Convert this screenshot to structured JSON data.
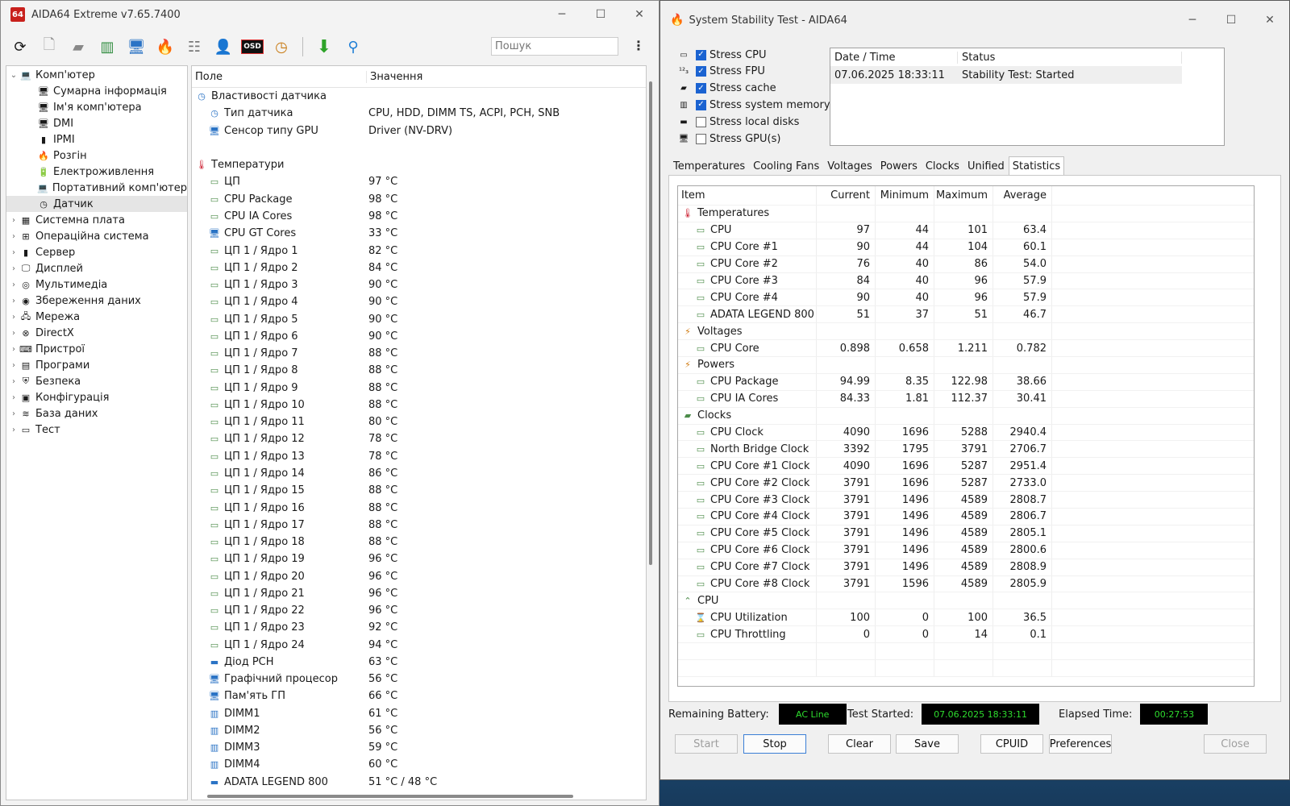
{
  "left_window": {
    "logo": "64",
    "title": "AIDA64 Extreme v7.65.7400",
    "search_placeholder": "Пошук",
    "tree": [
      {
        "label": "Комп'ютер",
        "indent": 0,
        "expanded": true,
        "icon": "💻"
      },
      {
        "label": "Сумарна інформація",
        "indent": 1,
        "icon": "🖥"
      },
      {
        "label": "Ім'я комп'ютера",
        "indent": 1,
        "icon": "🖥"
      },
      {
        "label": "DMI",
        "indent": 1,
        "icon": "🖥"
      },
      {
        "label": "IPMI",
        "indent": 1,
        "icon": "▮"
      },
      {
        "label": "Розгін",
        "indent": 1,
        "icon": "🔥"
      },
      {
        "label": "Електроживлення",
        "indent": 1,
        "icon": "🔋"
      },
      {
        "label": "Портативний комп'ютер",
        "indent": 1,
        "icon": "💻"
      },
      {
        "label": "Датчик",
        "indent": 1,
        "icon": "◷",
        "selected": true
      },
      {
        "label": "Системна плата",
        "indent": 0,
        "icon": "▦"
      },
      {
        "label": "Операційна система",
        "indent": 0,
        "icon": "⊞"
      },
      {
        "label": "Сервер",
        "indent": 0,
        "icon": "▮"
      },
      {
        "label": "Дисплей",
        "indent": 0,
        "icon": "🖵"
      },
      {
        "label": "Мультимедіа",
        "indent": 0,
        "icon": "◎"
      },
      {
        "label": "Збереження даних",
        "indent": 0,
        "icon": "◉"
      },
      {
        "label": "Мережа",
        "indent": 0,
        "icon": "🖧"
      },
      {
        "label": "DirectX",
        "indent": 0,
        "icon": "⊗"
      },
      {
        "label": "Пристрої",
        "indent": 0,
        "icon": "⌨"
      },
      {
        "label": "Програми",
        "indent": 0,
        "icon": "▤"
      },
      {
        "label": "Безпека",
        "indent": 0,
        "icon": "⛨"
      },
      {
        "label": "Конфігурація",
        "indent": 0,
        "icon": "▣"
      },
      {
        "label": "База даних",
        "indent": 0,
        "icon": "≋"
      },
      {
        "label": "Тест",
        "indent": 0,
        "icon": "▭"
      }
    ],
    "grid_header": {
      "field": "Поле",
      "value": "Значення"
    },
    "grid_rows": [
      {
        "type": "section",
        "field": "Властивості датчика",
        "icon": "◷"
      },
      {
        "field": "Тип датчика",
        "value": "CPU, HDD, DIMM TS, ACPI, PCH, SNB",
        "icon": "◷"
      },
      {
        "field": "Сенсор типу GPU",
        "value": "Driver  (NV-DRV)",
        "icon": "🖥"
      },
      {
        "type": "blank"
      },
      {
        "type": "section",
        "field": "Температури",
        "icon": "🌡"
      },
      {
        "field": "ЦП",
        "value": "97 °C"
      },
      {
        "field": "CPU Package",
        "value": "98 °C"
      },
      {
        "field": "CPU IA Cores",
        "value": "98 °C"
      },
      {
        "field": "CPU GT Cores",
        "value": "33 °C",
        "icon": "🖥"
      },
      {
        "field": "ЦП 1 / Ядро 1",
        "value": "82 °C"
      },
      {
        "field": "ЦП 1 / Ядро 2",
        "value": "84 °C"
      },
      {
        "field": "ЦП 1 / Ядро 3",
        "value": "90 °C"
      },
      {
        "field": "ЦП 1 / Ядро 4",
        "value": "90 °C"
      },
      {
        "field": "ЦП 1 / Ядро 5",
        "value": "90 °C"
      },
      {
        "field": "ЦП 1 / Ядро 6",
        "value": "90 °C"
      },
      {
        "field": "ЦП 1 / Ядро 7",
        "value": "88 °C"
      },
      {
        "field": "ЦП 1 / Ядро 8",
        "value": "88 °C"
      },
      {
        "field": "ЦП 1 / Ядро 9",
        "value": "88 °C"
      },
      {
        "field": "ЦП 1 / Ядро 10",
        "value": "88 °C"
      },
      {
        "field": "ЦП 1 / Ядро 11",
        "value": "80 °C"
      },
      {
        "field": "ЦП 1 / Ядро 12",
        "value": "78 °C"
      },
      {
        "field": "ЦП 1 / Ядро 13",
        "value": "78 °C"
      },
      {
        "field": "ЦП 1 / Ядро 14",
        "value": "86 °C"
      },
      {
        "field": "ЦП 1 / Ядро 15",
        "value": "88 °C"
      },
      {
        "field": "ЦП 1 / Ядро 16",
        "value": "88 °C"
      },
      {
        "field": "ЦП 1 / Ядро 17",
        "value": "88 °C"
      },
      {
        "field": "ЦП 1 / Ядро 18",
        "value": "88 °C"
      },
      {
        "field": "ЦП 1 / Ядро 19",
        "value": "96 °C"
      },
      {
        "field": "ЦП 1 / Ядро 20",
        "value": "96 °C"
      },
      {
        "field": "ЦП 1 / Ядро 21",
        "value": "96 °C"
      },
      {
        "field": "ЦП 1 / Ядро 22",
        "value": "96 °C"
      },
      {
        "field": "ЦП 1 / Ядро 23",
        "value": "92 °C"
      },
      {
        "field": "ЦП 1 / Ядро 24",
        "value": "94 °C"
      },
      {
        "field": "Діод PCH",
        "value": "63 °C",
        "icon": "▬"
      },
      {
        "field": "Графічний процесор",
        "value": "56 °C",
        "icon": "🖥"
      },
      {
        "field": "Пам'ять ГП",
        "value": "66 °C",
        "icon": "🖥"
      },
      {
        "field": "DIMM1",
        "value": "61 °C",
        "icon": "▥"
      },
      {
        "field": "DIMM2",
        "value": "56 °C",
        "icon": "▥"
      },
      {
        "field": "DIMM3",
        "value": "59 °C",
        "icon": "▥"
      },
      {
        "field": "DIMM4",
        "value": "60 °C",
        "icon": "▥"
      },
      {
        "field": "ADATA LEGEND 800",
        "value": "51 °C / 48 °C",
        "icon": "▬"
      }
    ]
  },
  "right_window": {
    "title": "System Stability Test - AIDA64",
    "stress": [
      {
        "label": "Stress CPU",
        "checked": true,
        "icon": "▭"
      },
      {
        "label": "Stress FPU",
        "checked": true,
        "icon": "¹²₃"
      },
      {
        "label": "Stress cache",
        "checked": true,
        "icon": "▰"
      },
      {
        "label": "Stress system memory",
        "checked": true,
        "icon": "▥"
      },
      {
        "label": "Stress local disks",
        "checked": false,
        "icon": "▬"
      },
      {
        "label": "Stress GPU(s)",
        "checked": false,
        "icon": "🖥"
      }
    ],
    "status_header": {
      "date": "Date / Time",
      "status": "Status"
    },
    "status_rows": [
      {
        "date": "07.06.2025 18:33:11",
        "status": "Stability Test: Started"
      }
    ],
    "tabs": [
      "Temperatures",
      "Cooling Fans",
      "Voltages",
      "Powers",
      "Clocks",
      "Unified",
      "Statistics"
    ],
    "active_tab": "Statistics",
    "stats_header": {
      "item": "Item",
      "current": "Current",
      "minimum": "Minimum",
      "maximum": "Maximum",
      "average": "Average"
    },
    "stats_rows": [
      {
        "type": "group",
        "item": "Temperatures",
        "icon": "🌡"
      },
      {
        "item": "CPU",
        "current": "97",
        "minimum": "44",
        "maximum": "101",
        "average": "63.4"
      },
      {
        "item": "CPU Core #1",
        "current": "90",
        "minimum": "44",
        "maximum": "104",
        "average": "60.1"
      },
      {
        "item": "CPU Core #2",
        "current": "76",
        "minimum": "40",
        "maximum": "86",
        "average": "54.0"
      },
      {
        "item": "CPU Core #3",
        "current": "84",
        "minimum": "40",
        "maximum": "96",
        "average": "57.9"
      },
      {
        "item": "CPU Core #4",
        "current": "90",
        "minimum": "40",
        "maximum": "96",
        "average": "57.9"
      },
      {
        "item": "ADATA LEGEND 800",
        "current": "51",
        "minimum": "37",
        "maximum": "51",
        "average": "46.7"
      },
      {
        "type": "group",
        "item": "Voltages",
        "icon": "⚡"
      },
      {
        "item": "CPU Core",
        "current": "0.898",
        "minimum": "0.658",
        "maximum": "1.211",
        "average": "0.782"
      },
      {
        "type": "group",
        "item": "Powers",
        "icon": "⚡"
      },
      {
        "item": "CPU Package",
        "current": "94.99",
        "minimum": "8.35",
        "maximum": "122.98",
        "average": "38.66"
      },
      {
        "item": "CPU IA Cores",
        "current": "84.33",
        "minimum": "1.81",
        "maximum": "112.37",
        "average": "30.41"
      },
      {
        "type": "group",
        "item": "Clocks",
        "icon": "▰"
      },
      {
        "item": "CPU Clock",
        "current": "4090",
        "minimum": "1696",
        "maximum": "5288",
        "average": "2940.4"
      },
      {
        "item": "North Bridge Clock",
        "current": "3392",
        "minimum": "1795",
        "maximum": "3791",
        "average": "2706.7"
      },
      {
        "item": "CPU Core #1 Clock",
        "current": "4090",
        "minimum": "1696",
        "maximum": "5287",
        "average": "2951.4"
      },
      {
        "item": "CPU Core #2 Clock",
        "current": "3791",
        "minimum": "1696",
        "maximum": "5287",
        "average": "2733.0"
      },
      {
        "item": "CPU Core #3 Clock",
        "current": "3791",
        "minimum": "1496",
        "maximum": "4589",
        "average": "2808.7"
      },
      {
        "item": "CPU Core #4 Clock",
        "current": "3791",
        "minimum": "1496",
        "maximum": "4589",
        "average": "2806.7"
      },
      {
        "item": "CPU Core #5 Clock",
        "current": "3791",
        "minimum": "1496",
        "maximum": "4589",
        "average": "2805.1"
      },
      {
        "item": "CPU Core #6 Clock",
        "current": "3791",
        "minimum": "1496",
        "maximum": "4589",
        "average": "2800.6"
      },
      {
        "item": "CPU Core #7 Clock",
        "current": "3791",
        "minimum": "1496",
        "maximum": "4589",
        "average": "2808.9"
      },
      {
        "item": "CPU Core #8 Clock",
        "current": "3791",
        "minimum": "1596",
        "maximum": "4589",
        "average": "2805.9"
      },
      {
        "type": "group",
        "item": "CPU",
        "icon": "⌃"
      },
      {
        "item": "CPU Utilization",
        "current": "100",
        "minimum": "0",
        "maximum": "100",
        "average": "36.5",
        "icon": "⌛"
      },
      {
        "item": "CPU Throttling",
        "current": "0",
        "minimum": "0",
        "maximum": "14",
        "average": "0.1"
      }
    ],
    "remaining_battery_label": "Remaining Battery:",
    "remaining_battery_value": "AC Line",
    "test_started_label": "Test Started:",
    "test_started_value": "07.06.2025 18:33:11",
    "elapsed_label": "Elapsed Time:",
    "elapsed_value": "00:27:53",
    "buttons": {
      "start": "Start",
      "stop": "Stop",
      "clear": "Clear",
      "save": "Save",
      "cpuid": "CPUID",
      "preferences": "Preferences",
      "close": "Close"
    }
  },
  "colors": {
    "led_bg": "#000000",
    "led_text": "#2edc2e",
    "checkbox_on": "#1b63d1",
    "logo_red": "#c8201c"
  }
}
